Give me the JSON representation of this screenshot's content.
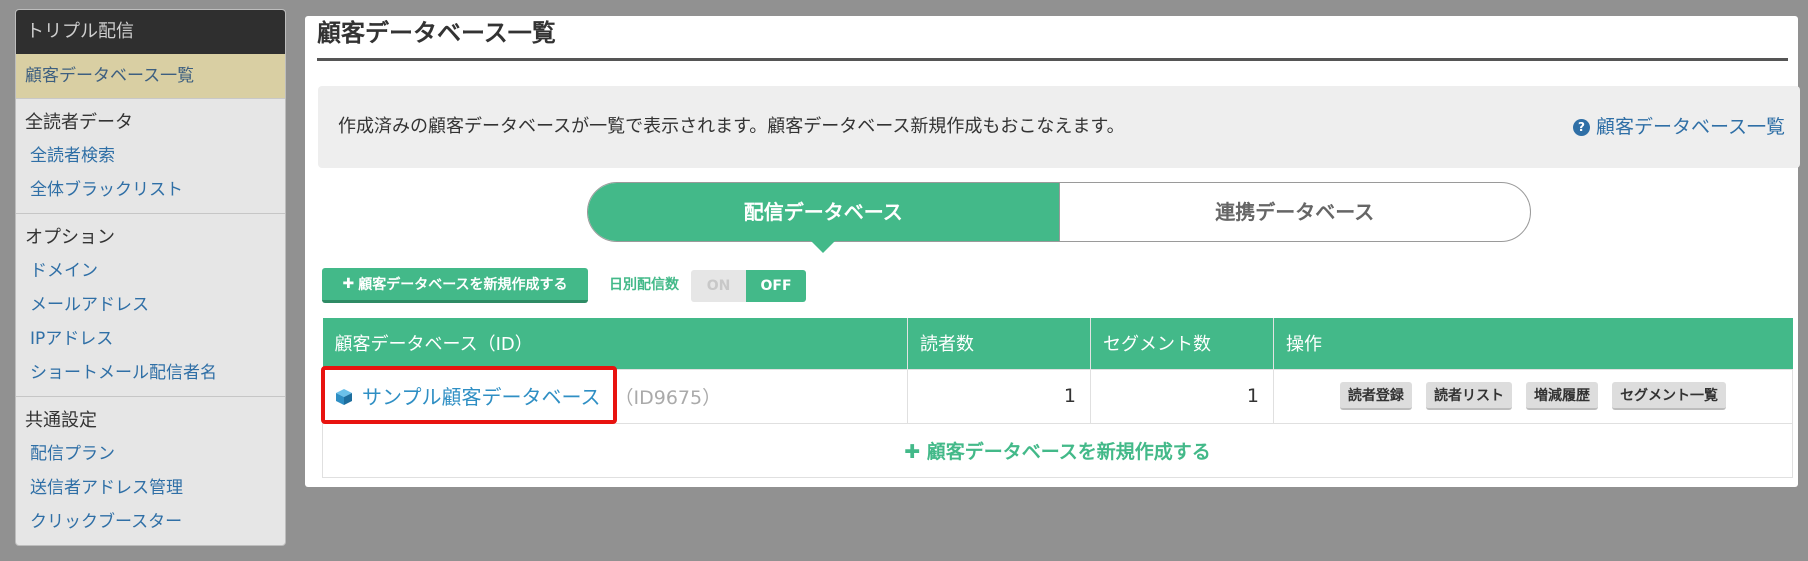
{
  "sidebar": {
    "app_title": "トリプル配信",
    "active_item": "顧客データベース一覧",
    "sections": [
      {
        "title": "全読者データ",
        "items": [
          "全読者検索",
          "全体ブラックリスト"
        ]
      },
      {
        "title": "オプション",
        "items": [
          "ドメイン",
          "メールアドレス",
          "IPアドレス",
          "ショートメール配信者名"
        ]
      },
      {
        "title": "共通設定",
        "items": [
          "配信プラン",
          "送信者アドレス管理",
          "クリックブースター"
        ]
      }
    ]
  },
  "main": {
    "page_title": "顧客データベース一覧",
    "info_text": "作成済みの顧客データベースが一覧で表示されます。顧客データベース新規作成もおこなえます。",
    "help_link": "顧客データベース一覧",
    "tabs": [
      {
        "label": "配信データベース",
        "active": true
      },
      {
        "label": "連携データベース",
        "active": false
      }
    ],
    "create_button": "顧客データベースを新規作成する",
    "daily_count_label": "日別配信数",
    "toggle": {
      "on": "ON",
      "off": "OFF",
      "selected": "OFF"
    },
    "table": {
      "headers": [
        "顧客データベース（ID）",
        "読者数",
        "セグメント数",
        "操作"
      ],
      "rows": [
        {
          "name": "サンプル顧客データベース",
          "id": "（ID9675）",
          "readers": "1",
          "segments": "1",
          "actions": [
            "読者登録",
            "読者リスト",
            "増減履歴",
            "セグメント一覧"
          ]
        }
      ],
      "footer_create": "顧客データベースを新規作成する"
    }
  },
  "colors": {
    "accent": "#43b989",
    "link": "#2f6fa6",
    "highlight": "#e8130f"
  }
}
